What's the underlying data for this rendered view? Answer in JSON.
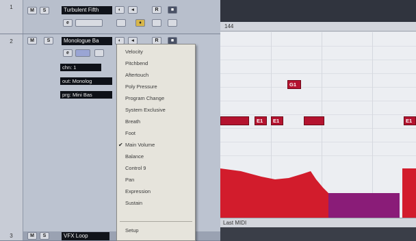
{
  "tracks": [
    {
      "number": "1",
      "name": "Turbulent Fifth"
    },
    {
      "number": "2",
      "name": "Monologue Ba"
    },
    {
      "number": "3",
      "name": "VFX Loop"
    }
  ],
  "track_buttons": {
    "mute": "M",
    "solo": "S",
    "read": "R",
    "write": "W"
  },
  "track2_fields": {
    "channel": "chn: 1",
    "output": "out: Monolog",
    "program": "prg: Mini Bas"
  },
  "menu": {
    "items": [
      {
        "label": "Velocity",
        "checked": false
      },
      {
        "label": "Pitchbend",
        "checked": false
      },
      {
        "label": "Aftertouch",
        "checked": false
      },
      {
        "label": "Poly Pressure",
        "checked": false
      },
      {
        "label": "Program Change",
        "checked": false
      },
      {
        "label": "System Exclusive",
        "checked": false
      },
      {
        "label": "Breath",
        "checked": false
      },
      {
        "label": "Foot",
        "checked": false
      },
      {
        "label": "Main Volume",
        "checked": true
      },
      {
        "label": "Balance",
        "checked": false
      },
      {
        "label": "Control 9",
        "checked": false
      },
      {
        "label": "Pan",
        "checked": false
      },
      {
        "label": "Expression",
        "checked": false
      },
      {
        "label": "Sustain",
        "checked": false
      }
    ],
    "setup_label": "Setup"
  },
  "editor": {
    "ruler_label": "144",
    "notes": [
      {
        "label": "G1"
      },
      {
        "label": ""
      },
      {
        "label": "E1"
      },
      {
        "label": "E1"
      },
      {
        "label": ""
      },
      {
        "label": "E1"
      }
    ],
    "status": "Last MIDI"
  },
  "colors": {
    "note": "#b4132f",
    "velocity_red": "#d21c2c",
    "velocity_purple": "#8a1c78"
  }
}
